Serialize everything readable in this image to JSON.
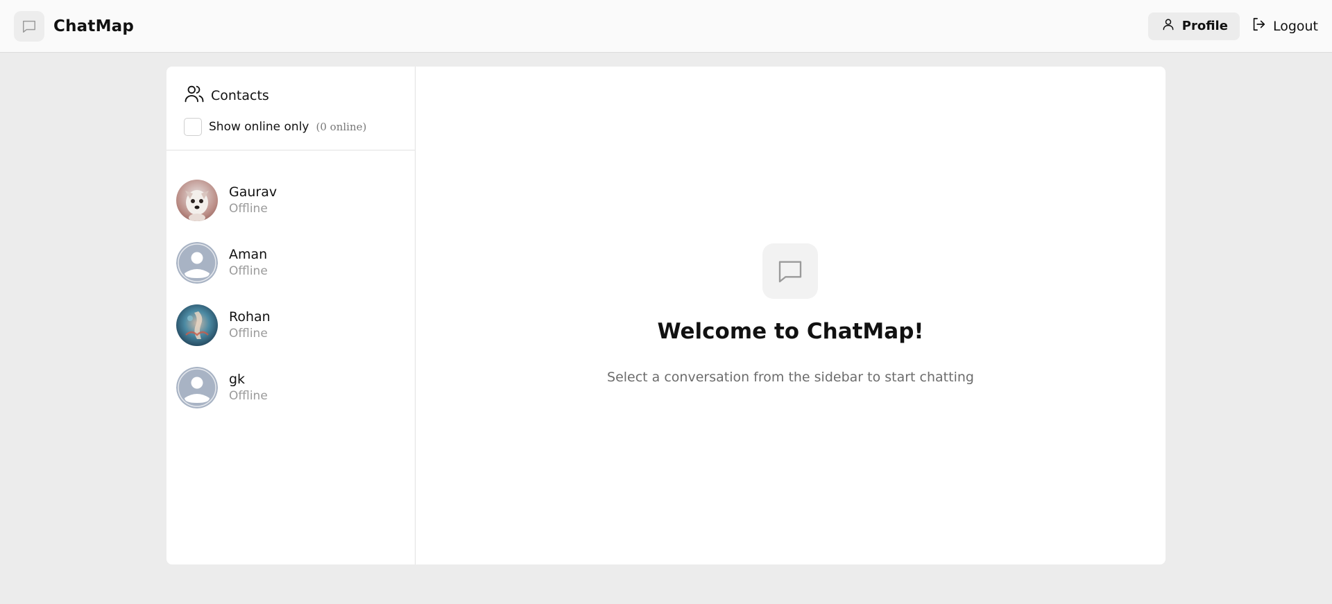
{
  "header": {
    "brand_name": "ChatMap",
    "brand_icon": "chat-bubble-icon",
    "profile_label": "Profile",
    "profile_icon": "user-icon",
    "logout_label": "Logout",
    "logout_icon": "logout-icon"
  },
  "sidebar": {
    "title": "Contacts",
    "title_icon": "users-icon",
    "filter_label": "Show online only",
    "filter_checked": false,
    "online_count": "(0 online)",
    "contacts": [
      {
        "name": "Gaurav",
        "status": "Offline",
        "avatar": "dog-photo"
      },
      {
        "name": "Aman",
        "status": "Offline",
        "avatar": "default-avatar"
      },
      {
        "name": "Rohan",
        "status": "Offline",
        "avatar": "artwork-photo"
      },
      {
        "name": "gk",
        "status": "Offline",
        "avatar": "default-avatar"
      }
    ]
  },
  "welcome": {
    "icon": "chat-bubble-icon",
    "title": "Welcome to ChatMap!",
    "subtitle": "Select a conversation from the sidebar to start chatting"
  },
  "colors": {
    "background": "#ececec",
    "header_bg": "#fafafa",
    "card_bg": "#ffffff",
    "muted_text": "#9a9a9a",
    "default_avatar": "#a8b3c4"
  }
}
